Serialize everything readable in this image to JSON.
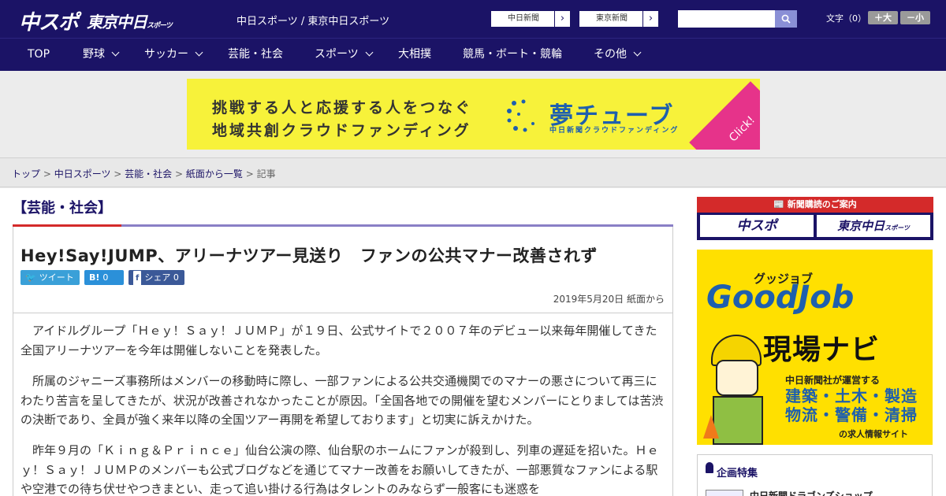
{
  "header": {
    "logo": "中スポ",
    "logo2": "東京中日",
    "logo2_small": "スポーツ",
    "site_title": "中日スポーツ / 東京中日スポーツ",
    "link_chunichi": "中日新聞",
    "link_tokyo": "東京新聞",
    "search_placeholder": "",
    "font_size_label": "文字（0）",
    "font_larger": "＋大",
    "font_smaller": "－小"
  },
  "nav": {
    "items": [
      {
        "label": "TOP",
        "has_menu": false
      },
      {
        "label": "野球",
        "has_menu": true
      },
      {
        "label": "サッカー",
        "has_menu": true
      },
      {
        "label": "芸能・社会",
        "has_menu": false
      },
      {
        "label": "スポーツ",
        "has_menu": true
      },
      {
        "label": "大相撲",
        "has_menu": false
      },
      {
        "label": "競馬・ボート・競輪",
        "has_menu": false
      },
      {
        "label": "その他",
        "has_menu": true
      }
    ]
  },
  "banner": {
    "line1": "挑戦する人と応援する人をつなぐ",
    "line2": "地域共創クラウドファンディング",
    "brand": "夢チューブ",
    "brand_sub": "中日新聞クラウドファンディング",
    "click": "Click!"
  },
  "breadcrumb": {
    "items": [
      "トップ",
      "中日スポーツ",
      "芸能・社会",
      "紙面から一覧"
    ],
    "current": "記事",
    "sep": " > "
  },
  "article": {
    "category": "【芸能・社会】",
    "headline": "Hey!Say!JUMP、アリーナツアー見送り　ファンの公共マナー改善されず",
    "tweet": "ツイート",
    "hatena_icon": "B!",
    "hatena_count": "0",
    "share_label": "シェア",
    "share_count": "0",
    "date": "2019年5月20日 紙面から",
    "paragraphs": [
      "アイドルグループ「Ｈｅｙ！Ｓａｙ！ＪＵＭＰ」が１９日、公式サイトで２００７年のデビュー以来毎年開催してきた全国アリーナツアーを今年は開催しないことを発表した。",
      "所属のジャニーズ事務所はメンバーの移動時に際し、一部ファンによる公共交通機関でのマナーの悪さについて再三にわたり苦言を呈してきたが、状況が改善されなかったことが原因。「全国各地での開催を望むメンバーにとりましては苦渋の決断であり、全員が強く来年以降の全国ツアー再開を希望しております」と切実に訴えかけた。",
      "昨年９月の「Ｋｉｎｇ＆Ｐｒｉｎｃｅ」仙台公演の際、仙台駅のホームにファンが殺到し、列車の遅延を招いた。Ｈｅｙ！Ｓａｙ！ＪＵＭＰのメンバーも公式ブログなどを通じてマナー改善をお願いしてきたが、一部悪質なファンによる駅や空港での待ち伏せやつきまとい、走って追い掛ける行為はタレントのみならず一般客にも迷惑を"
    ]
  },
  "sidebar": {
    "subscribe_header": "新聞購読のご案内",
    "sub_chuspo": "中スポ",
    "sub_tokyo": "東京中日",
    "sub_tokyo_small": "スポーツ",
    "ad_top": "グッジョブ",
    "ad_brand": "GoodJob",
    "ad_title": "現場ナビ",
    "ad_sub": "中日新聞社が運営する",
    "ad_fields1": "建築・土木・製造",
    "ad_fields2": "物流・警備・清掃",
    "ad_foot": "の求人情報サイト",
    "feature_title": "企画特集",
    "feature_item": "中日新聞ドラゴンズショップ"
  }
}
